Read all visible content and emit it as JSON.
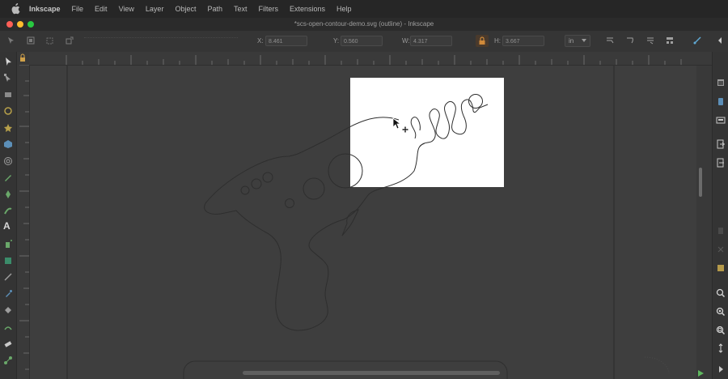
{
  "menubar": {
    "items": [
      "Inkscape",
      "File",
      "Edit",
      "View",
      "Layer",
      "Object",
      "Path",
      "Text",
      "Filters",
      "Extensions",
      "Help"
    ]
  },
  "window": {
    "title": "*scs-open-contour-demo.svg (outline) - Inkscape",
    "traffic_lights": [
      "#ff5f57",
      "#febc2e",
      "#28c840"
    ]
  },
  "tool_controls": {
    "x_label": "X:",
    "x_value": "8.461",
    "y_label": "Y:",
    "y_value": "0.560",
    "w_label": "W:",
    "w_value": "4.317",
    "h_label": "H:",
    "h_value": "3.667",
    "unit": "in"
  },
  "icons": {
    "toolbox": [
      "selector-icon",
      "node-tool-icon",
      "rectangle-tool-icon",
      "circle-tool-icon",
      "star-tool-icon",
      "3d-box-icon",
      "spiral-tool-icon",
      "pencil-tool-icon",
      "pen-tool-icon",
      "calligraphy-tool-icon",
      "text-tool-icon",
      "spray-tool-icon",
      "mesh-tool-icon",
      "gradient-tool-icon",
      "dropper-icon",
      "paint-bucket-icon",
      "tweak-tool-icon",
      "eraser-icon",
      "connector-icon"
    ],
    "commands": [
      "new-document-icon",
      "open-icon",
      "save-icon",
      "print-icon",
      "import-icon",
      "export-icon",
      "copy-icon",
      "paste-icon",
      "zoom-selection-icon",
      "zoom-drawing-icon",
      "zoom-page-icon",
      "zoom-fit-icon",
      "expand-icon"
    ]
  },
  "colors": {
    "canvas": "#3e3e3e",
    "page_border": "#2a2a2a",
    "outline_stroke": "#2f2f2f",
    "selection_bg": "#ffffff"
  }
}
